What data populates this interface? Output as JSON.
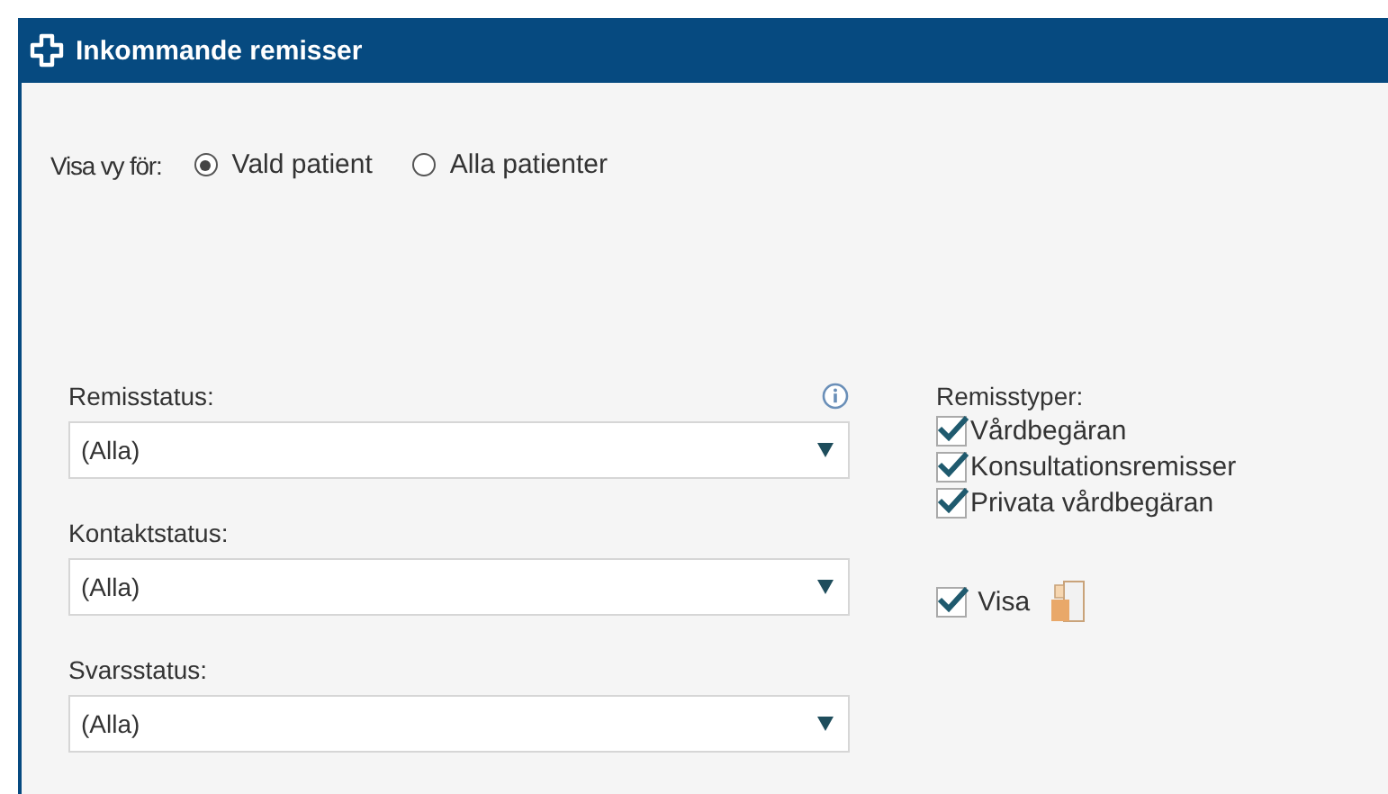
{
  "panel": {
    "title": "Inkommande remisser"
  },
  "view_for": {
    "label": "Visa vy för:",
    "options": [
      {
        "label": "Vald patient",
        "selected": true
      },
      {
        "label": "Alla patienter",
        "selected": false
      }
    ]
  },
  "filters": [
    {
      "label": "Remisstatus:",
      "value": "(Alla)",
      "info": true
    },
    {
      "label": "Kontaktstatus:",
      "value": "(Alla)",
      "info": false
    },
    {
      "label": "Svarsstatus:",
      "value": "(Alla)",
      "info": false
    }
  ],
  "referral_types": {
    "label": "Remisstyper:",
    "items": [
      {
        "label": "Vårdbegäran",
        "checked": true
      },
      {
        "label": "Konsultationsremisser",
        "checked": true
      },
      {
        "label": "Privata vårdbegäran",
        "checked": true
      }
    ]
  },
  "show": {
    "label": "Visa",
    "checked": true
  }
}
